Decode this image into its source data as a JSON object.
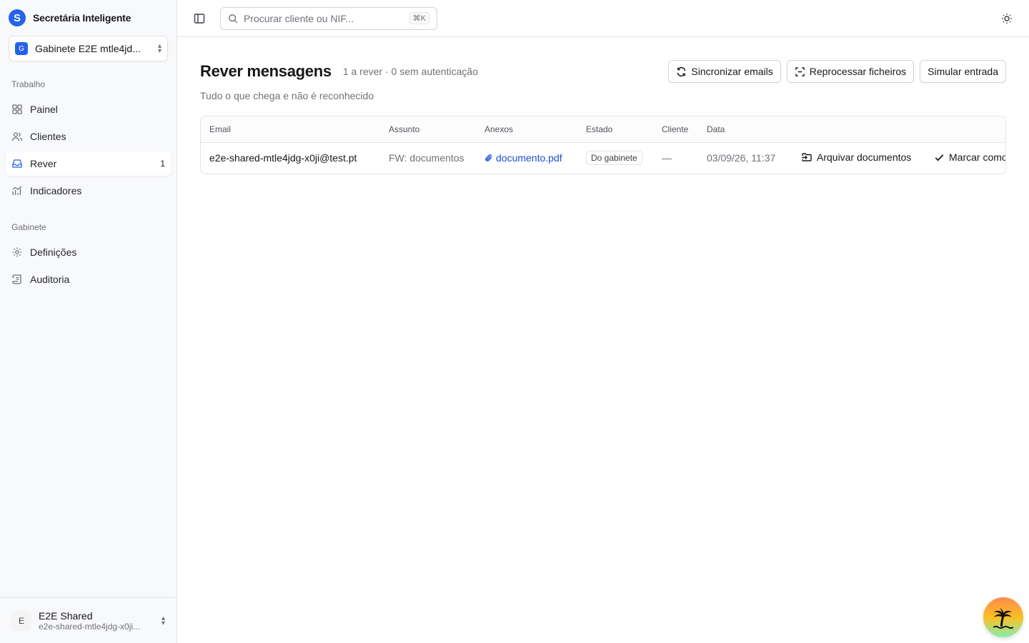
{
  "brand": {
    "name": "Secretária Inteligente",
    "logo_letter": "S"
  },
  "workspace": {
    "badge": "G",
    "name": "Gabinete E2E mtle4jd..."
  },
  "nav": {
    "groups": [
      {
        "label": "Trabalho",
        "items": [
          {
            "label": "Painel",
            "icon": "dashboard-icon"
          },
          {
            "label": "Clientes",
            "icon": "users-icon"
          },
          {
            "label": "Rever",
            "icon": "inbox-icon",
            "count": "1",
            "active": true
          },
          {
            "label": "Indicadores",
            "icon": "chart-icon"
          }
        ]
      },
      {
        "label": "Gabinete",
        "items": [
          {
            "label": "Definições",
            "icon": "gear-icon"
          },
          {
            "label": "Auditoria",
            "icon": "scroll-icon"
          }
        ]
      }
    ]
  },
  "user": {
    "initial": "E",
    "name": "E2E Shared",
    "email": "e2e-shared-mtle4jdg-x0ji..."
  },
  "topbar": {
    "search_placeholder": "Procurar cliente ou NIF...",
    "shortcut": "⌘K"
  },
  "page": {
    "title": "Rever mensagens",
    "meta": "1 a rever · 0 sem autenticação",
    "subtitle": "Tudo o que chega e não é reconhecido",
    "actions": {
      "sync": "Sincronizar emails",
      "reprocess": "Reprocessar ficheiros",
      "simulate": "Simular entrada"
    }
  },
  "table": {
    "columns": [
      "Email",
      "Assunto",
      "Anexos",
      "Estado",
      "Cliente",
      "Data"
    ],
    "rows": [
      {
        "email": "e2e-shared-mtle4jdg-x0ji@test.pt",
        "subject": "FW: documentos",
        "attachment": "documento.pdf",
        "status": "Do gabinete",
        "client": "—",
        "date": "03/09/26, 11:37",
        "action_archive": "Arquivar documentos",
        "action_mark": "Marcar como tratado"
      }
    ]
  }
}
